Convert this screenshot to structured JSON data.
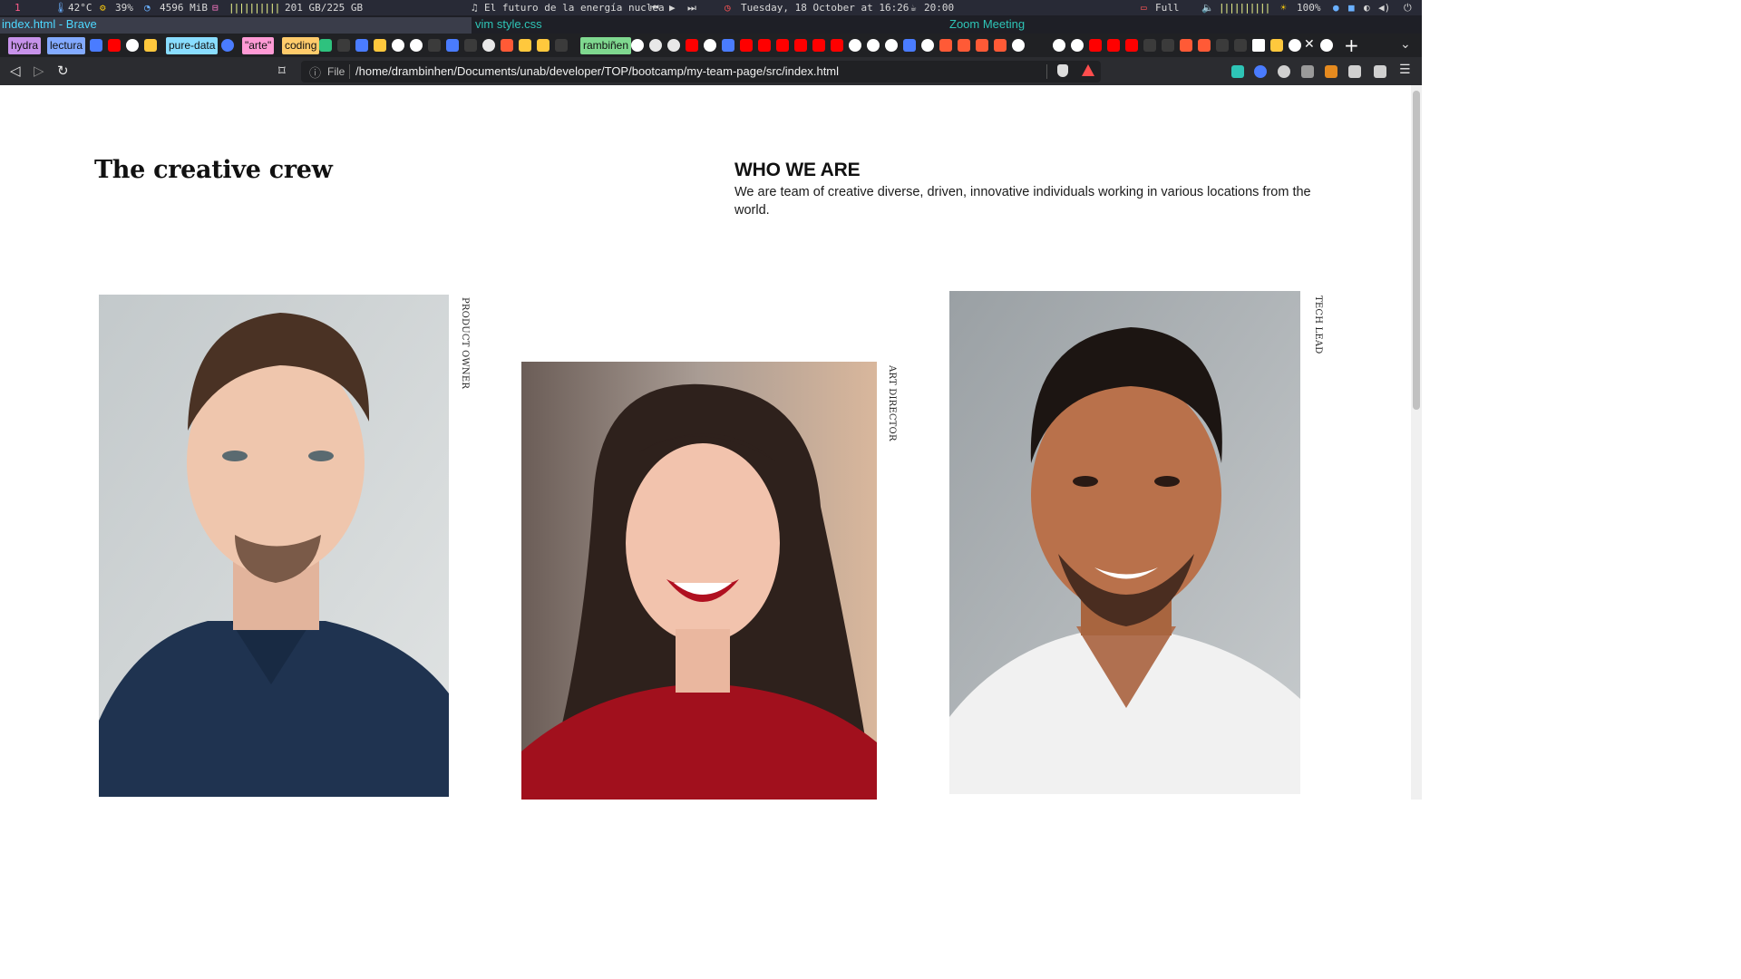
{
  "statusbar": {
    "workspace": "1",
    "temperature": "42°C",
    "cpu": "39%",
    "memory": "4596 MiB",
    "disk_bars": "||||||||||",
    "disk": "201 GB/225 GB",
    "now_playing": "El futuro de la energía nuclea",
    "clock": "Tuesday, 18 October at 16:26",
    "timer": "20:00",
    "battery": "Full",
    "volume_bars": "||||||||||",
    "brightness": "100%"
  },
  "windows": {
    "active": "index.html - Brave",
    "second": "vim style.css",
    "third": "Zoom Meeting"
  },
  "tab_groups": [
    {
      "label": "hydra",
      "color": "#c792ea"
    },
    {
      "label": "lectura",
      "color": "#82aaff"
    },
    {
      "label": "pure-data",
      "color": "#89ddff"
    },
    {
      "label": "\"arte\"",
      "color": "#ff9ad5"
    },
    {
      "label": "coding",
      "color": "#ffcb6b"
    },
    {
      "label": "rambiñen",
      "color": "#7fd88f"
    }
  ],
  "browser": {
    "url_scheme": "File",
    "url": "/home/drambinhen/Documents/unab/developer/TOP/bootcamp/my-team-page/src/index.html",
    "back_icon": "◁",
    "forward_icon": "▷",
    "reload_icon": "↻",
    "bookmark_icon": "⌑",
    "info_icon": "ⓘ",
    "close_icon": "✕",
    "new_tab_icon": "+",
    "menu_icon": "☰",
    "chevron_icon": "⌄"
  },
  "page": {
    "title": "The creative crew",
    "who_heading": "WHO WE ARE",
    "who_text": "We are team of creative diverse, driven, innovative individuals working in various locations from the world."
  },
  "team": [
    {
      "role": "PRODUCT OWNER",
      "photo": "man-in-navy-polo-photo"
    },
    {
      "role": "ART DIRECTOR",
      "photo": "woman-in-red-sweater-photo"
    },
    {
      "role": "TECH LEAD",
      "photo": "man-in-white-tshirt-photo"
    }
  ]
}
